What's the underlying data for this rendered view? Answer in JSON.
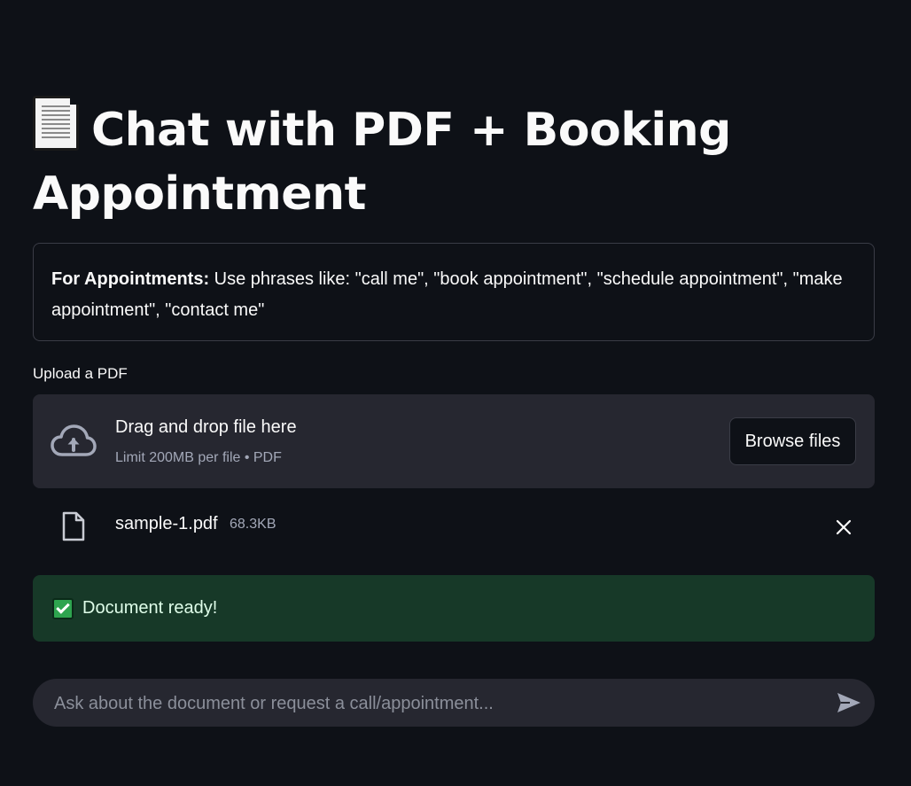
{
  "header": {
    "emoji_icon": "page-facing-up-icon",
    "title": "Chat with PDF + Booking Appointment"
  },
  "info": {
    "bold_label": "For Appointments:",
    "text": " Use phrases like: \"call me\", \"book appointment\", \"schedule appointment\", \"make appointment\", \"contact me\""
  },
  "uploader": {
    "label": "Upload a PDF",
    "drop_text": "Drag and drop file here",
    "limit_text": "Limit 200MB per file • PDF",
    "browse_label": "Browse files",
    "icon": "cloud-upload-icon"
  },
  "uploaded_file": {
    "name": "sample-1.pdf",
    "size": "68.3KB",
    "icon": "file-icon",
    "remove_icon": "close-icon"
  },
  "status": {
    "icon": "check-mark-icon",
    "message": "Document ready!"
  },
  "chat": {
    "placeholder": "Ask about the document or request a call/appointment...",
    "value": "",
    "send_icon": "send-icon"
  },
  "colors": {
    "background": "#0e1117",
    "surface": "#262730",
    "success_bg": "#173928",
    "text": "#fafafa",
    "muted": "#a3a8b8"
  }
}
